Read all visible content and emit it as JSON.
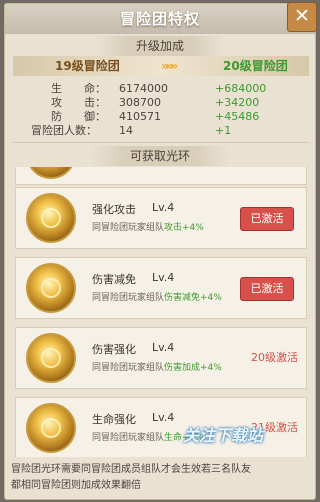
{
  "window": {
    "title": "冒险团特权"
  },
  "upgrade": {
    "header": "升级加成",
    "current_level": "19级冒险团",
    "arrow": "»»»",
    "next_level": "20级冒险团",
    "stats": [
      {
        "label": "生　　命：",
        "value": "6174000",
        "bonus": "+684000"
      },
      {
        "label": "攻　　击：",
        "value": "308700",
        "bonus": "+34200"
      },
      {
        "label": "防　　御：",
        "value": "410571",
        "bonus": "+45486"
      },
      {
        "label": "冒险团人数：",
        "value": "14",
        "bonus": "+1"
      }
    ]
  },
  "auras": {
    "header": "可获取光环",
    "items": [
      {
        "name": "强化攻击",
        "level": "Lv.4",
        "desc_prefix": "同冒险团玩家组队",
        "desc_effect": "攻击+4%",
        "status": "已激活",
        "active": true
      },
      {
        "name": "伤害减免",
        "level": "Lv.4",
        "desc_prefix": "同冒险团玩家组队",
        "desc_effect": "伤害减免+4%",
        "status": "已激活",
        "active": true
      },
      {
        "name": "伤害强化",
        "level": "Lv.4",
        "desc_prefix": "同冒险团玩家组队",
        "desc_effect": "伤害加成+4%",
        "status": "20级激活",
        "active": false
      },
      {
        "name": "生命强化",
        "level": "Lv.4",
        "desc_prefix": "同冒险团玩家组队",
        "desc_effect": "生命+4%",
        "status": "21级激活",
        "active": false
      }
    ]
  },
  "footer": {
    "line1": "冒险团光环需要同冒险团成员组队才会生效若三名队友",
    "line2": "都相同冒险团则加成效果翻倍"
  },
  "watermark": "关注下载站",
  "colors": {
    "active_red": "#d7514a",
    "bonus_green": "#3c9a2e",
    "close_orange": "#c58a45"
  }
}
